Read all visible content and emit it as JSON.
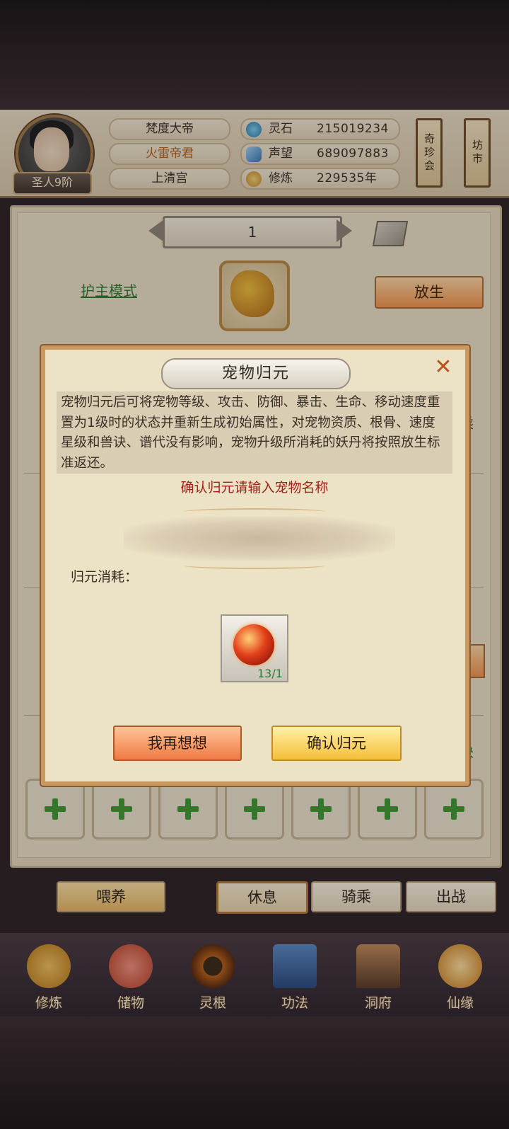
{
  "header": {
    "rank": "圣人9阶",
    "name_pills": [
      "梵度大帝",
      "火雷帝君",
      "上清宫"
    ],
    "stats": [
      {
        "icon": "spirit-stone-icon",
        "label": "灵石",
        "value": "215019234"
      },
      {
        "icon": "reputation-icon",
        "label": "声望",
        "value": "689097883"
      },
      {
        "icon": "cultivation-icon",
        "label": "修炼",
        "value": "229535年"
      }
    ],
    "banners": [
      "奇珍会",
      "坊市"
    ]
  },
  "pet_panel": {
    "number": "1",
    "guard_mode": "护主模式",
    "release_button": "放生",
    "peek_right_1": "乘",
    "peek_right_2": "诀"
  },
  "bottom_buttons": [
    "喂养",
    "休息",
    "骑乘",
    "出战"
  ],
  "nav": [
    {
      "label": "修炼",
      "icon": "meditate-icon",
      "color": "#d89a3a"
    },
    {
      "label": "储物",
      "icon": "bag-icon",
      "color": "#d9604a"
    },
    {
      "label": "灵根",
      "icon": "spirit-root-icon",
      "color": "#b04a1a"
    },
    {
      "label": "功法",
      "icon": "book-icon",
      "color": "#3a6aa8"
    },
    {
      "label": "洞府",
      "icon": "cave-icon",
      "color": "#8a5a3a"
    },
    {
      "label": "仙缘",
      "icon": "gourd-icon",
      "color": "#e0a030"
    }
  ],
  "dialog": {
    "title": "宠物归元",
    "close": "✕",
    "description": "宠物归元后可将宠物等级、攻击、防御、暴击、生命、移动速度重置为1级时的状态并重新生成初始属性，对宠物资质、根骨、速度星级和兽诀、谱代没有影响，宠物升级所消耗的妖丹将按照放生标准返还。",
    "prompt": "确认归元请输入宠物名称",
    "input_value": "",
    "cost_label": "归元消耗：",
    "item_count": "13/1",
    "cancel_button": "我再想想",
    "confirm_button": "确认归元"
  },
  "colors": {
    "accent": "#c89a62",
    "warning_text": "#a1221a",
    "link_green": "#2f7a2f"
  }
}
